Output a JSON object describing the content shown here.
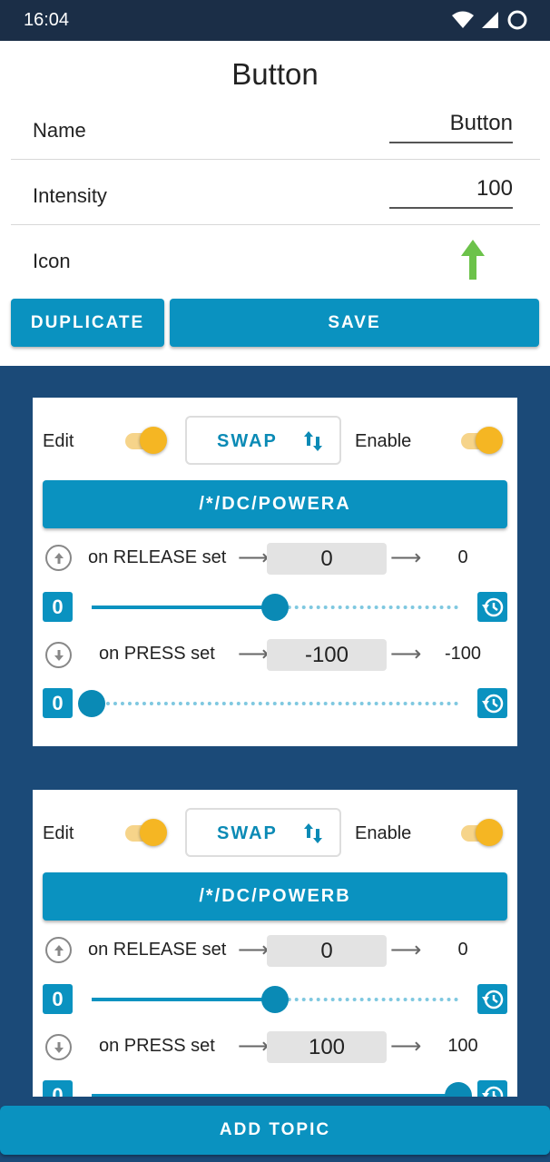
{
  "status": {
    "time": "16:04"
  },
  "header": {
    "title": "Button",
    "fields": [
      {
        "label": "Name",
        "value": "Button"
      },
      {
        "label": "Intensity",
        "value": "100"
      },
      {
        "label": "Icon",
        "icon": "arrow-up-icon",
        "icon_color": "#6cc24a"
      }
    ],
    "duplicate_label": "DUPLICATE",
    "save_label": "SAVE"
  },
  "colors": {
    "accent": "#0a92c0",
    "background": "#1b4a78",
    "toggle": "#f5b623"
  },
  "topics": [
    {
      "edit_label": "Edit",
      "edit_on": true,
      "swap_label": "SWAP",
      "enable_label": "Enable",
      "enable_on": true,
      "topic": "/*/DC/POWERA",
      "release": {
        "label": "on RELEASE set",
        "value": "0",
        "result": "0",
        "badge": "0",
        "slider": 0.5
      },
      "press": {
        "label": "on PRESS set",
        "value": "-100",
        "result": "-100",
        "badge": "0",
        "slider": 0.0
      }
    },
    {
      "edit_label": "Edit",
      "edit_on": true,
      "swap_label": "SWAP",
      "enable_label": "Enable",
      "enable_on": true,
      "topic": "/*/DC/POWERB",
      "release": {
        "label": "on RELEASE set",
        "value": "0",
        "result": "0",
        "badge": "0",
        "slider": 0.5
      },
      "press": {
        "label": "on PRESS set",
        "value": "100",
        "result": "100",
        "badge": "0",
        "slider": 1.0
      }
    }
  ],
  "add_topic_label": "ADD TOPIC"
}
